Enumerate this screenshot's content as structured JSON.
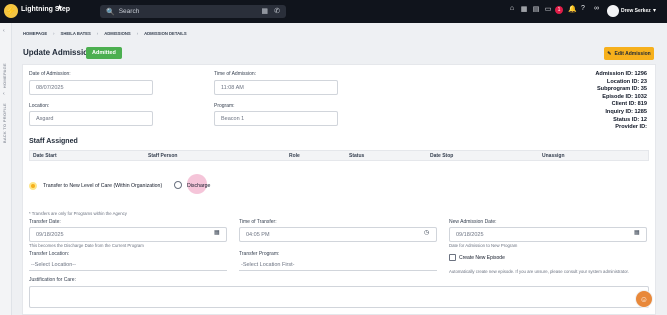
{
  "topbar": {
    "brand": "Lightning Step",
    "search_placeholder": "Search",
    "notification_count": "1",
    "user_name": "Drew Serkez"
  },
  "sidebar": {
    "homepage": "HOMEPAGE",
    "back_to_profile": "BACK TO PROFILE"
  },
  "breadcrumb": [
    "HOMEPAGE",
    "SHEILA BATES",
    "ADMISSIONS",
    "ADMISSION DETAILS"
  ],
  "page": {
    "title": "Update Admission",
    "status": "Admitted",
    "edit_label": "Edit Admission"
  },
  "admission": {
    "date_label": "Date of Admission:",
    "date_value": "08/07/2025",
    "time_label": "Time of Admission:",
    "time_value": "11:08 AM",
    "location_label": "Location:",
    "location_value": "Asgard",
    "program_label": "Program:",
    "program_value": "Beacon 1"
  },
  "ids": [
    "Admission ID: 1296",
    "Location ID: 23",
    "Subprogram ID: 35",
    "Episode ID: 1032",
    "Client ID: 819",
    "Inquiry ID: 1285",
    "Status ID: 12",
    "Provider ID:"
  ],
  "staff": {
    "title": "Staff Assigned",
    "columns": [
      "Date Start",
      "Staff Person",
      "Role",
      "Status",
      "Date Stop",
      "Unassign"
    ]
  },
  "options": {
    "transfer": "Transfer to New Level of Care (Within Organization)",
    "discharge": "Discharge"
  },
  "transfer": {
    "note": "* Transfers are only for Programs within the Agency",
    "date_label": "Transfer Date:",
    "date_value": "09/18/2025",
    "date_note": "This becomes the Discharge Date from the Current Program",
    "time_label": "Time of Transfer:",
    "time_value": "04:05 PM",
    "new_date_label": "New Admission Date:",
    "new_date_value": "09/18/2025",
    "new_date_note": "Date for Admission to New Program",
    "location_label": "Transfer Location:",
    "location_value": "--Select Location--",
    "program_label": "Transfer Program:",
    "program_value": "-Select Location First-",
    "episode_label": "Create New Episode",
    "episode_note": "Automatically create new episode. If you are unsure, please consult your system administrator.",
    "justification_label": "Justification for Care:"
  },
  "colors": {
    "accent": "#f6b01c",
    "status": "#4caf50",
    "radio": "#f6b01c",
    "topbar": "#10141c"
  },
  "icons": [
    "lightning-icon",
    "star-icon",
    "search-icon",
    "calendar-icon",
    "phone-icon",
    "bell-icon",
    "gear-icon",
    "chat-icon",
    "calendar-picker-icon",
    "clock-icon",
    "edit-icon"
  ]
}
